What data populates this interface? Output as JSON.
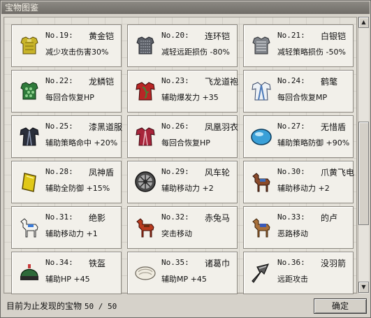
{
  "window": {
    "title": "宝物图鉴"
  },
  "items": [
    {
      "no": "No.19:",
      "name": "黄金铠",
      "effect": "减少攻击伤害30%",
      "icon": "gold-armor-icon"
    },
    {
      "no": "No.20:",
      "name": "连环铠",
      "effect": "减轻远距损伤 -80%",
      "icon": "chain-armor-icon"
    },
    {
      "no": "No.21:",
      "name": "白银铠",
      "effect": "减轻策略损伤 -50%",
      "icon": "silver-armor-icon"
    },
    {
      "no": "No.22:",
      "name": "龙鳞铠",
      "effect": "每回合恢复HP",
      "icon": "dragon-scale-armor-icon"
    },
    {
      "no": "No.23:",
      "name": "飞龙道袍",
      "effect": "辅助爆发力 +35",
      "icon": "flying-dragon-robe-icon"
    },
    {
      "no": "No.24:",
      "name": "鹤氅",
      "effect": "每回合恢复MP",
      "icon": "crane-cloak-icon"
    },
    {
      "no": "No.25:",
      "name": "漆黑道服",
      "effect": "辅助策略命中 +20%",
      "icon": "black-robe-icon"
    },
    {
      "no": "No.26:",
      "name": "凤凰羽衣",
      "effect": "每回合恢复HP",
      "icon": "phoenix-robe-icon"
    },
    {
      "no": "No.27:",
      "name": "无惜盾",
      "effect": "辅助策略防御 +90%",
      "icon": "blue-shield-icon"
    },
    {
      "no": "No.28:",
      "name": "凤神盾",
      "effect": "辅助全防御 +15%",
      "icon": "gold-shield-icon"
    },
    {
      "no": "No.29:",
      "name": "风车轮",
      "effect": "辅助移动力 +2",
      "icon": "wheel-icon"
    },
    {
      "no": "No.30:",
      "name": "爪黄飞电",
      "effect": "辅助移动力 +2",
      "icon": "horse-icon"
    },
    {
      "no": "No.31:",
      "name": "绝影",
      "effect": "辅助移动力 +1",
      "icon": "white-horse-icon"
    },
    {
      "no": "No.32:",
      "name": "赤兔马",
      "effect": "突击移动",
      "icon": "red-horse-icon"
    },
    {
      "no": "No.33:",
      "name": "的卢",
      "effect": "恶路移动",
      "icon": "saddled-horse-icon"
    },
    {
      "no": "No.34:",
      "name": "铁盔",
      "effect": "辅助HP +45",
      "icon": "iron-helmet-icon"
    },
    {
      "no": "No.35:",
      "name": "诸葛巾",
      "effect": "辅助MP +45",
      "icon": "turban-icon"
    },
    {
      "no": "No.36:",
      "name": "没羽箭",
      "effect": "远距攻击",
      "icon": "arrowhead-icon"
    }
  ],
  "status": {
    "label": "目前为止发现的宝物",
    "count": "50 / 50"
  },
  "buttons": {
    "ok": "确定"
  },
  "scrollbar": {
    "up": "▲",
    "down": "▼"
  }
}
